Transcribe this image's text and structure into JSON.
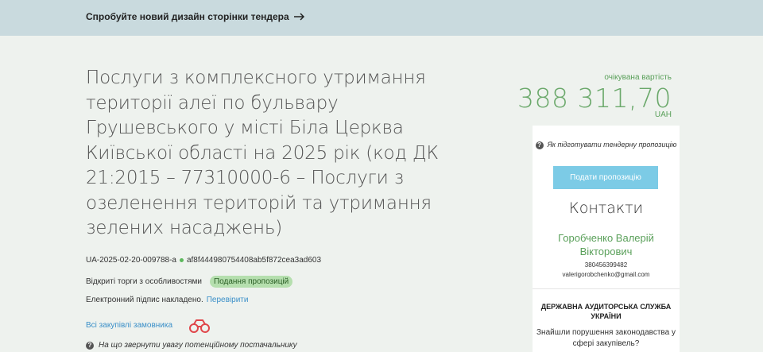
{
  "banner": {
    "link_text": "Спробуйте новий дизайн сторінки тендера"
  },
  "tender": {
    "title": "Послуги з комплексного утримання території алеї по бульвару Грушевського у місті Біла Церква Київської області на 2025 рік (код ДК 21:2015 – 77310000-6 – Послуги з озеленення територій та утримання зелених насаджень)",
    "tender_id": "UA-2025-02-20-009788-a",
    "hash": "af8f444980754408ab5f872cea3ad603",
    "procedure": "Відкриті торги з особливостями",
    "status_badge": "Подання пропозицій",
    "signature_text": "Електронний підпис накладено.",
    "signature_link": "Перевірити",
    "all_purchases_link": "Всі закупівлі замовника",
    "attention_text": "На що звернути увагу потенційному постачальнику"
  },
  "value": {
    "label": "очікувана вартість",
    "amount": "388 311,70",
    "currency": "UAH"
  },
  "panel": {
    "how_to_text": "Як підготувати тендерну пропозицію",
    "submit_button": "Подати пропозицію",
    "contacts_title": "Контакти",
    "contact_name": "Горобченко Валерій Вікторович",
    "contact_phone": "380456399482",
    "contact_email": "valerigorobchenko@gmail.com",
    "audit_title": "ДЕРЖАВНА АУДИТОРСЬКА СЛУЖБА УКРАЇНИ",
    "audit_text": "Знайшли порушення законодавства у сфері закупівель?"
  },
  "colors": {
    "banner_bg": "#c9dade",
    "page_bg": "#eef2ee",
    "accent_green": "#6aa86a",
    "button_blue": "#7ccbe6",
    "link_blue": "#3a8fc8"
  },
  "icons": [
    "arrow-right-icon",
    "status-dot-icon",
    "binoculars-icon",
    "question-icon"
  ]
}
